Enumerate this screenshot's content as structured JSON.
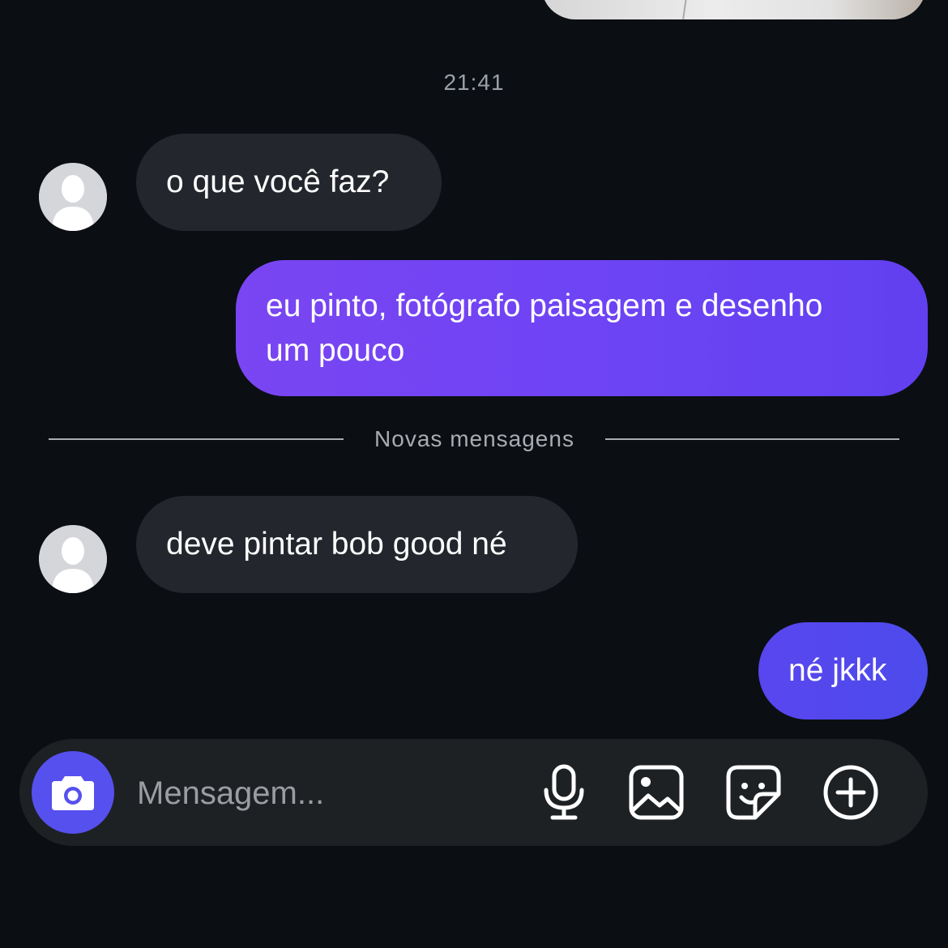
{
  "chat": {
    "timestamp": "21:41",
    "messages": [
      {
        "direction": "incoming",
        "text": "o que você faz?"
      },
      {
        "direction": "outgoing",
        "text_line1": "eu pinto, fotógrafo paisagem e desenho",
        "text_line2": "um pouco"
      },
      {
        "direction": "incoming",
        "text": "deve pintar bob good né"
      },
      {
        "direction": "outgoing",
        "text": "né jkkk"
      }
    ],
    "new_messages_divider": "Novas mensagens"
  },
  "composer": {
    "placeholder": "Mensagem...",
    "icons": [
      "camera-icon",
      "microphone-icon",
      "gallery-icon",
      "sticker-icon",
      "plus-circle-icon"
    ]
  },
  "colors": {
    "background": "#0b0f14",
    "incoming_bubble": "#23272d",
    "outgoing_bubble_purple": "#6d44f4",
    "outgoing_bubble_blue": "#5349ed",
    "camera_button": "#5650ee",
    "composer_bar": "#1d2124"
  }
}
